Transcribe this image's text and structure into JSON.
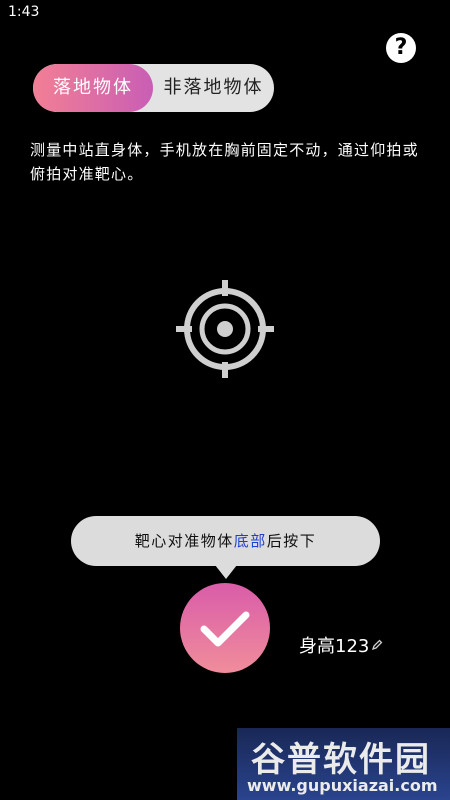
{
  "status_bar": {
    "time": "1:43"
  },
  "help": {
    "label": "?"
  },
  "mode_toggle": {
    "active_label": "落地物体",
    "inactive_label": "非落地物体"
  },
  "instruction": {
    "text": "测量中站直身体，手机放在胸前固定不动，通过仰拍或俯拍对准靶心。"
  },
  "icons": {
    "crosshair": "crosshair-icon",
    "confirm": "checkmark-icon",
    "edit": "pencil-icon"
  },
  "tooltip": {
    "prefix": "靶心对准物体",
    "highlight": "底部",
    "suffix": "后按下"
  },
  "height": {
    "label": "身高123"
  },
  "watermark": {
    "title": "谷普软件园",
    "url": "www.gupuxiazai.com"
  },
  "colors": {
    "accent_start": "#f27f95",
    "accent_end": "#c95eb4",
    "highlight_text": "#1f3fd1",
    "icon_gray": "#cfcfcf"
  }
}
